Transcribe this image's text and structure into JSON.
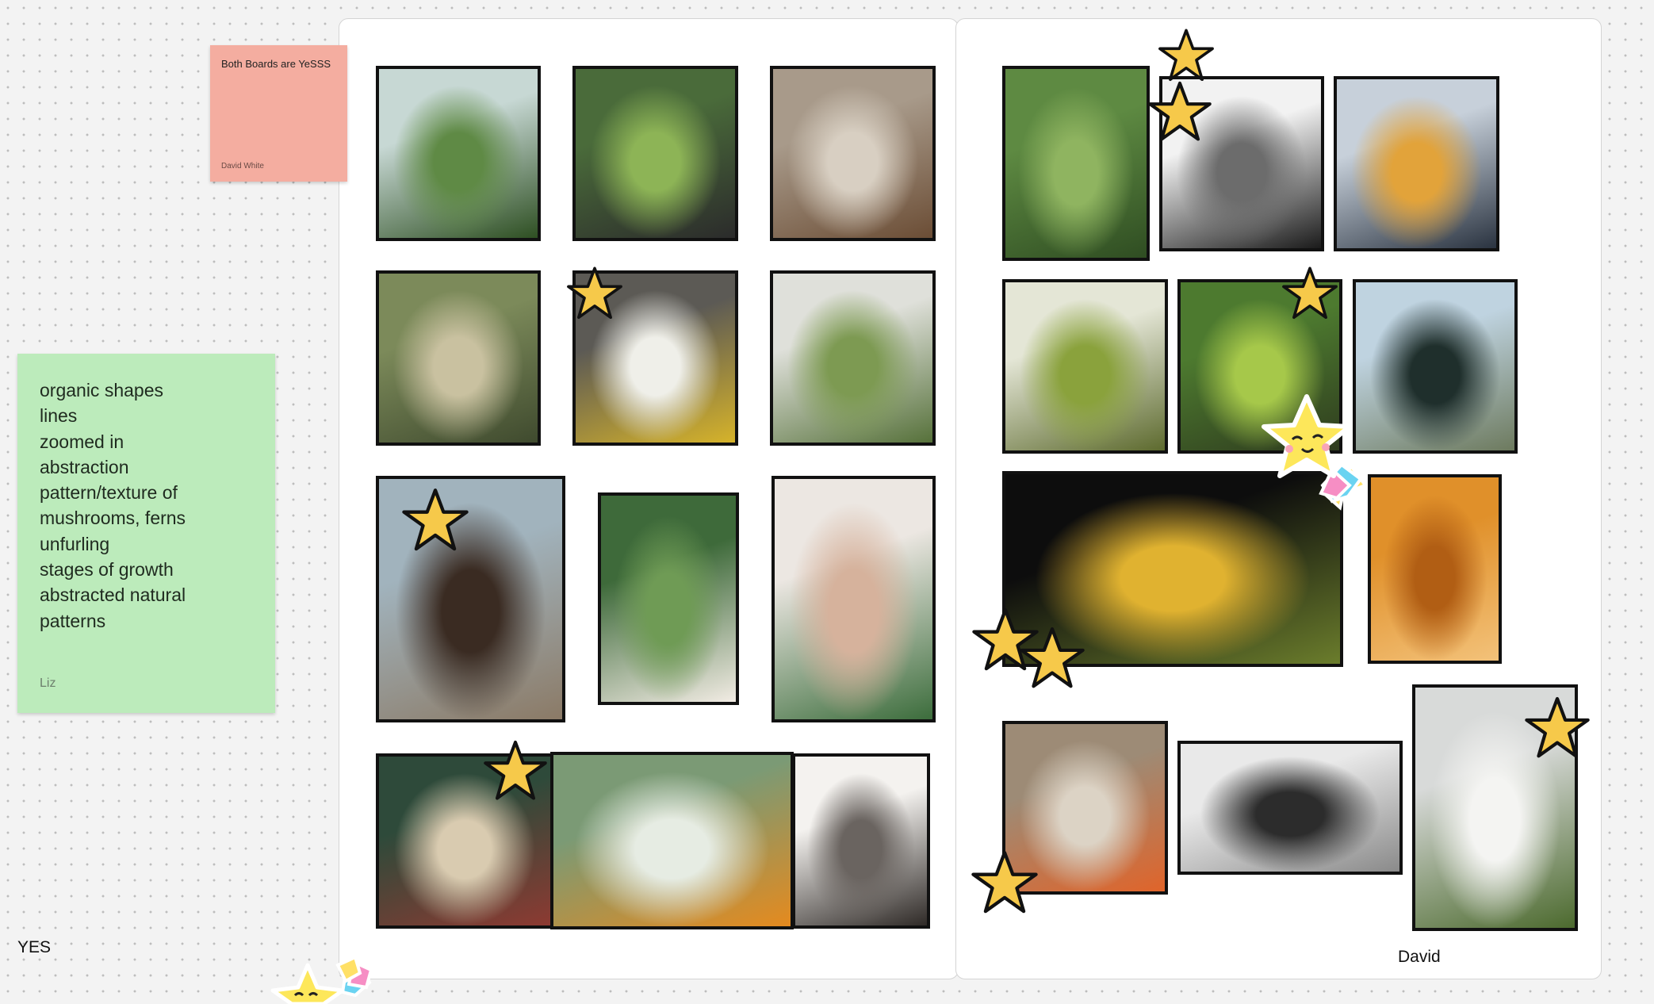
{
  "colors": {
    "canvas": "#f3f3f3",
    "board": "#ffffff",
    "sticky_pink": "#f4ada0",
    "sticky_green": "#bcebbb",
    "star_fill": "#f6c94a",
    "star_outline": "#111111"
  },
  "sticky_pink": {
    "title": "Both Boards are YeSSS",
    "author": "David White"
  },
  "sticky_green": {
    "lines": [
      "organic shapes",
      "lines",
      "zoomed in",
      "abstraction",
      "pattern/texture of",
      "mushrooms, ferns",
      "unfurling",
      "stages of growth",
      "abstracted natural",
      "patterns"
    ],
    "author": "Liz"
  },
  "labels": {
    "yes": "YES",
    "david": "David"
  },
  "images_left": [
    {
      "name": "moss-hand-image",
      "colors": [
        "#c7d8d4",
        "#5f8a45",
        "#2e4f22"
      ]
    },
    {
      "name": "fern-stools-image",
      "colors": [
        "#4a6b3a",
        "#8db456",
        "#2b2b2b"
      ]
    },
    {
      "name": "curled-leaf-image",
      "colors": [
        "#a89a8a",
        "#d8cfc2",
        "#6b4d35"
      ]
    },
    {
      "name": "mossy-stairs-image",
      "colors": [
        "#7c8a5a",
        "#c9c1a0",
        "#3f4a2e"
      ]
    },
    {
      "name": "daisy-image",
      "colors": [
        "#5c5a55",
        "#efefe9",
        "#d6b32a"
      ]
    },
    {
      "name": "moss-figure-image",
      "colors": [
        "#dfe0da",
        "#7d9a52",
        "#56713a"
      ]
    },
    {
      "name": "roots-tree-image",
      "colors": [
        "#a1b3bd",
        "#3a2b22",
        "#8b7a66"
      ]
    },
    {
      "name": "skeleton-leaf-image",
      "colors": [
        "#3e6a3a",
        "#6f9b55",
        "#f2ece4"
      ]
    },
    {
      "name": "legs-flowers-image",
      "colors": [
        "#ece7e2",
        "#d6b29c",
        "#3c6d3c"
      ]
    },
    {
      "name": "veiled-figure-image",
      "colors": [
        "#2e4a3a",
        "#d9cbb0",
        "#8d3a32"
      ]
    },
    {
      "name": "moldy-orange-image",
      "colors": [
        "#7b9a75",
        "#e6ece3",
        "#e58a1e"
      ]
    },
    {
      "name": "dried-flower-image",
      "colors": [
        "#f4f2ef",
        "#6a6460",
        "#2f2a27"
      ]
    }
  ],
  "images_right": [
    {
      "name": "fern-collage-image",
      "colors": [
        "#5e8a42",
        "#8fb460",
        "#2f4d22"
      ]
    },
    {
      "name": "fiddleheads-bw-image",
      "colors": [
        "#f2f2f2",
        "#6c6c6c",
        "#1b1b1b"
      ]
    },
    {
      "name": "lab-flasks-image",
      "colors": [
        "#c7d0da",
        "#e2a33a",
        "#2a3340"
      ]
    },
    {
      "name": "kiwi-image",
      "colors": [
        "#e4e6d6",
        "#8aa23c",
        "#5d6a2e"
      ]
    },
    {
      "name": "fern-unfurl-image",
      "colors": [
        "#4d7a2f",
        "#a6c84a",
        "#2e3b1e"
      ]
    },
    {
      "name": "floating-head-image",
      "colors": [
        "#bfd3e0",
        "#1f2f2c",
        "#6d7a5e"
      ]
    },
    {
      "name": "iris-stages-image",
      "colors": [
        "#0d0d0d",
        "#e0b230",
        "#6b7d2c"
      ]
    },
    {
      "name": "mushroom-gills-image",
      "colors": [
        "#e0902a",
        "#b15e14",
        "#f3c27a"
      ]
    },
    {
      "name": "flower-bag-image",
      "colors": [
        "#9d8b76",
        "#dcd3c5",
        "#e0642a"
      ]
    },
    {
      "name": "tree-rings-image",
      "colors": [
        "#e9e9e9",
        "#2c2c2c",
        "#8a8a8a"
      ]
    },
    {
      "name": "plant-camera-image",
      "colors": [
        "#d8dad9",
        "#f4f4f2",
        "#4c6a2e"
      ]
    }
  ],
  "stars": [
    "star-daisy",
    "star-roots",
    "star-veiled",
    "star-fiddleheads-top",
    "star-fiddleheads",
    "star-fern-unfurl",
    "star-iris-1",
    "star-iris-2",
    "star-flower-bag",
    "star-camera"
  ],
  "stickers": [
    "cute-star-sticker",
    "cute-star-sticker-bottom"
  ]
}
